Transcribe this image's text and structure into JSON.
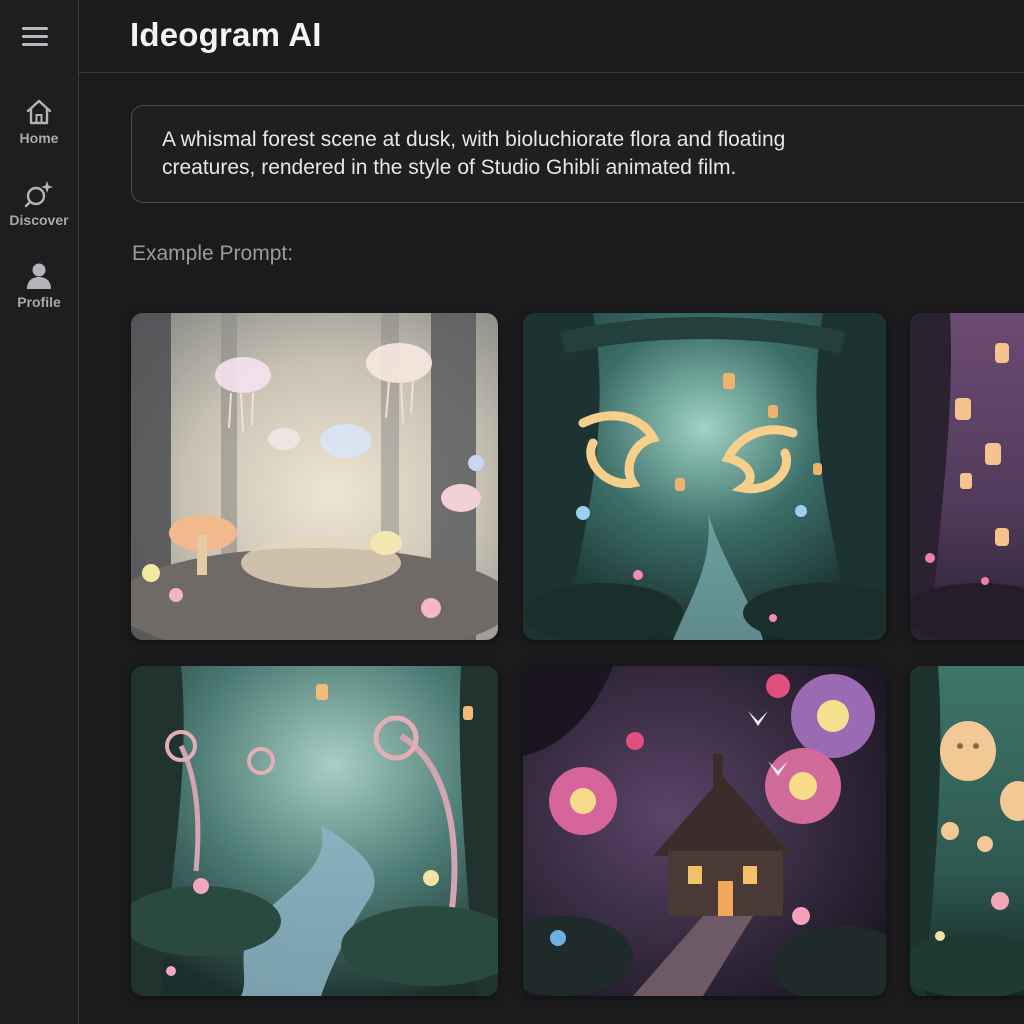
{
  "app": {
    "title": "Ideogram AI"
  },
  "sidebar": {
    "menu_icon": "hamburger-menu-icon",
    "items": [
      {
        "label": "Home",
        "icon": "home-icon"
      },
      {
        "label": "Discover",
        "icon": "discover-sparkle-icon"
      },
      {
        "label": "Profile",
        "icon": "profile-icon"
      }
    ]
  },
  "prompt": {
    "text": "A whismal forest scene at dusk, with bioluchiorate flora and floating creatures, rendered in the style of Studio Ghibli animated film."
  },
  "examples": {
    "label": "Example Prompt:",
    "images": [
      {
        "subject": "glowing jellyfish and mushrooms in misty forest"
      },
      {
        "subject": "golden dragons and floating lanterns over forest path"
      },
      {
        "subject": "lanterns in purple forest"
      },
      {
        "subject": "spiral plants along a glowing stream"
      },
      {
        "subject": "cottage with giant glowing flowers at night"
      },
      {
        "subject": "floating spirit creatures in green forest"
      }
    ]
  },
  "colors": {
    "background": "#1b1b1d",
    "sidebar": "#1e1e20",
    "border": "#3a3a3e",
    "text_primary": "#f4f4f6",
    "text_muted": "#9a9a9f"
  }
}
